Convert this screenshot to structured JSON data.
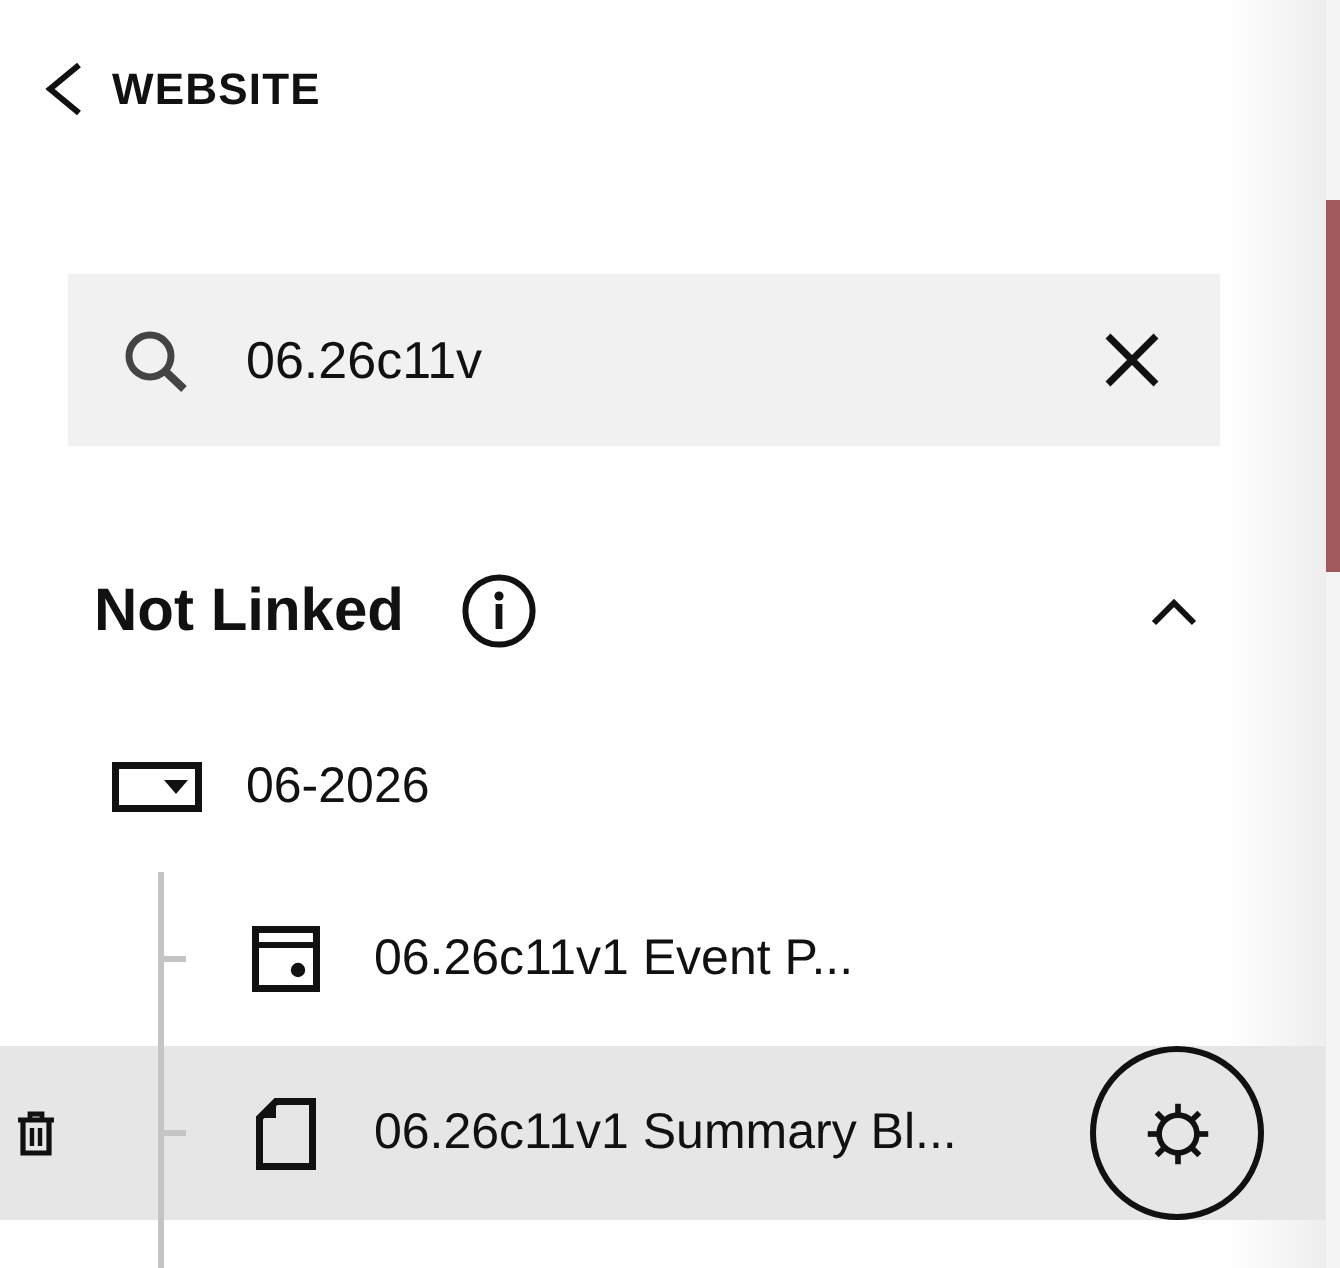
{
  "header": {
    "back_label": "WEBSITE"
  },
  "search": {
    "value": "06.26c11v"
  },
  "section": {
    "title": "Not Linked",
    "expanded": true,
    "folder": {
      "label": "06-2026",
      "children": [
        {
          "kind": "event",
          "label": "06.26c11v1 Event P...",
          "selected": false
        },
        {
          "kind": "summary",
          "label": "06.26c11v1 Summary Bl...",
          "selected": true
        }
      ]
    }
  }
}
